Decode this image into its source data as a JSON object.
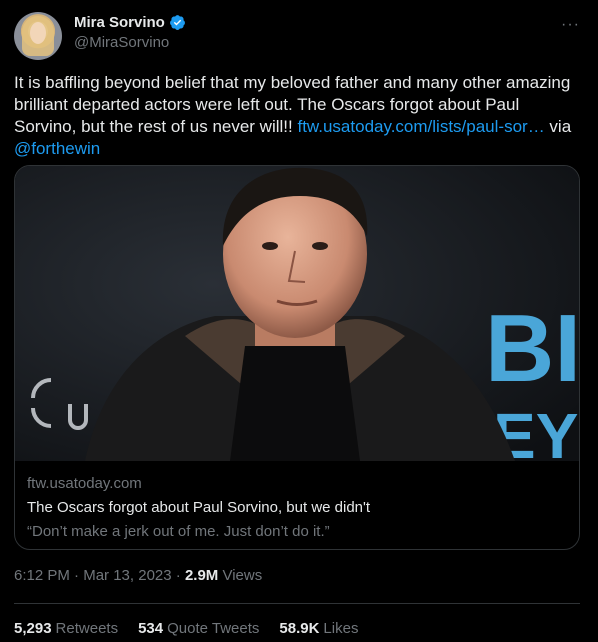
{
  "author": {
    "display_name": "Mira Sorvino",
    "handle": "@MiraSorvino",
    "verified": true
  },
  "menu_icon": "more-dots-icon",
  "tweet": {
    "text_before_link": "It is baffling beyond belief that my beloved father and many other amazing brilliant departed actors were left out. The Oscars forgot about Paul Sorvino, but the rest of us never will!! ",
    "link_text": "ftw.usatoday.com/lists/paul-sor…",
    "via_text": " via ",
    "mention": "@forthewin"
  },
  "card": {
    "image_text_right": "BI",
    "image_text_right2": "EYI",
    "domain": "ftw.usatoday.com",
    "title": "The Oscars forgot about Paul Sorvino, but we didn't",
    "description": "“Don’t make a jerk out of me. Just don’t do it.”"
  },
  "meta": {
    "time": "6:12 PM",
    "separator1": " · ",
    "date": "Mar 13, 2023",
    "separator2": " · ",
    "views_count": "2.9M",
    "views_label": " Views"
  },
  "stats": {
    "retweets_count": "5,293",
    "retweets_label": "Retweets",
    "quotes_count": "534",
    "quotes_label": "Quote Tweets",
    "likes_count": "58.9K",
    "likes_label": "Likes"
  },
  "colors": {
    "background": "#000000",
    "text": "#e7e9ea",
    "secondary": "#71767b",
    "link": "#1d9bf0",
    "border": "#2f3336"
  }
}
